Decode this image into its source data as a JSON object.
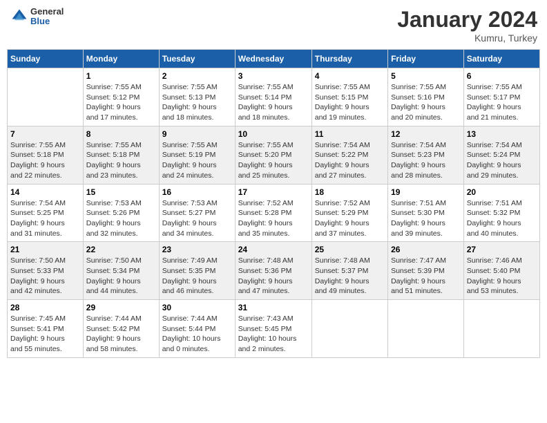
{
  "header": {
    "logo_general": "General",
    "logo_blue": "Blue",
    "month_title": "January 2024",
    "location": "Kumru, Turkey"
  },
  "days_of_week": [
    "Sunday",
    "Monday",
    "Tuesday",
    "Wednesday",
    "Thursday",
    "Friday",
    "Saturday"
  ],
  "weeks": [
    [
      {
        "day": "",
        "text": ""
      },
      {
        "day": "1",
        "text": "Sunrise: 7:55 AM\nSunset: 5:12 PM\nDaylight: 9 hours\nand 17 minutes."
      },
      {
        "day": "2",
        "text": "Sunrise: 7:55 AM\nSunset: 5:13 PM\nDaylight: 9 hours\nand 18 minutes."
      },
      {
        "day": "3",
        "text": "Sunrise: 7:55 AM\nSunset: 5:14 PM\nDaylight: 9 hours\nand 18 minutes."
      },
      {
        "day": "4",
        "text": "Sunrise: 7:55 AM\nSunset: 5:15 PM\nDaylight: 9 hours\nand 19 minutes."
      },
      {
        "day": "5",
        "text": "Sunrise: 7:55 AM\nSunset: 5:16 PM\nDaylight: 9 hours\nand 20 minutes."
      },
      {
        "day": "6",
        "text": "Sunrise: 7:55 AM\nSunset: 5:17 PM\nDaylight: 9 hours\nand 21 minutes."
      }
    ],
    [
      {
        "day": "7",
        "text": "Sunrise: 7:55 AM\nSunset: 5:18 PM\nDaylight: 9 hours\nand 22 minutes."
      },
      {
        "day": "8",
        "text": "Sunrise: 7:55 AM\nSunset: 5:18 PM\nDaylight: 9 hours\nand 23 minutes."
      },
      {
        "day": "9",
        "text": "Sunrise: 7:55 AM\nSunset: 5:19 PM\nDaylight: 9 hours\nand 24 minutes."
      },
      {
        "day": "10",
        "text": "Sunrise: 7:55 AM\nSunset: 5:20 PM\nDaylight: 9 hours\nand 25 minutes."
      },
      {
        "day": "11",
        "text": "Sunrise: 7:54 AM\nSunset: 5:22 PM\nDaylight: 9 hours\nand 27 minutes."
      },
      {
        "day": "12",
        "text": "Sunrise: 7:54 AM\nSunset: 5:23 PM\nDaylight: 9 hours\nand 28 minutes."
      },
      {
        "day": "13",
        "text": "Sunrise: 7:54 AM\nSunset: 5:24 PM\nDaylight: 9 hours\nand 29 minutes."
      }
    ],
    [
      {
        "day": "14",
        "text": "Sunrise: 7:54 AM\nSunset: 5:25 PM\nDaylight: 9 hours\nand 31 minutes."
      },
      {
        "day": "15",
        "text": "Sunrise: 7:53 AM\nSunset: 5:26 PM\nDaylight: 9 hours\nand 32 minutes."
      },
      {
        "day": "16",
        "text": "Sunrise: 7:53 AM\nSunset: 5:27 PM\nDaylight: 9 hours\nand 34 minutes."
      },
      {
        "day": "17",
        "text": "Sunrise: 7:52 AM\nSunset: 5:28 PM\nDaylight: 9 hours\nand 35 minutes."
      },
      {
        "day": "18",
        "text": "Sunrise: 7:52 AM\nSunset: 5:29 PM\nDaylight: 9 hours\nand 37 minutes."
      },
      {
        "day": "19",
        "text": "Sunrise: 7:51 AM\nSunset: 5:30 PM\nDaylight: 9 hours\nand 39 minutes."
      },
      {
        "day": "20",
        "text": "Sunrise: 7:51 AM\nSunset: 5:32 PM\nDaylight: 9 hours\nand 40 minutes."
      }
    ],
    [
      {
        "day": "21",
        "text": "Sunrise: 7:50 AM\nSunset: 5:33 PM\nDaylight: 9 hours\nand 42 minutes."
      },
      {
        "day": "22",
        "text": "Sunrise: 7:50 AM\nSunset: 5:34 PM\nDaylight: 9 hours\nand 44 minutes."
      },
      {
        "day": "23",
        "text": "Sunrise: 7:49 AM\nSunset: 5:35 PM\nDaylight: 9 hours\nand 46 minutes."
      },
      {
        "day": "24",
        "text": "Sunrise: 7:48 AM\nSunset: 5:36 PM\nDaylight: 9 hours\nand 47 minutes."
      },
      {
        "day": "25",
        "text": "Sunrise: 7:48 AM\nSunset: 5:37 PM\nDaylight: 9 hours\nand 49 minutes."
      },
      {
        "day": "26",
        "text": "Sunrise: 7:47 AM\nSunset: 5:39 PM\nDaylight: 9 hours\nand 51 minutes."
      },
      {
        "day": "27",
        "text": "Sunrise: 7:46 AM\nSunset: 5:40 PM\nDaylight: 9 hours\nand 53 minutes."
      }
    ],
    [
      {
        "day": "28",
        "text": "Sunrise: 7:45 AM\nSunset: 5:41 PM\nDaylight: 9 hours\nand 55 minutes."
      },
      {
        "day": "29",
        "text": "Sunrise: 7:44 AM\nSunset: 5:42 PM\nDaylight: 9 hours\nand 58 minutes."
      },
      {
        "day": "30",
        "text": "Sunrise: 7:44 AM\nSunset: 5:44 PM\nDaylight: 10 hours\nand 0 minutes."
      },
      {
        "day": "31",
        "text": "Sunrise: 7:43 AM\nSunset: 5:45 PM\nDaylight: 10 hours\nand 2 minutes."
      },
      {
        "day": "",
        "text": ""
      },
      {
        "day": "",
        "text": ""
      },
      {
        "day": "",
        "text": ""
      }
    ]
  ]
}
